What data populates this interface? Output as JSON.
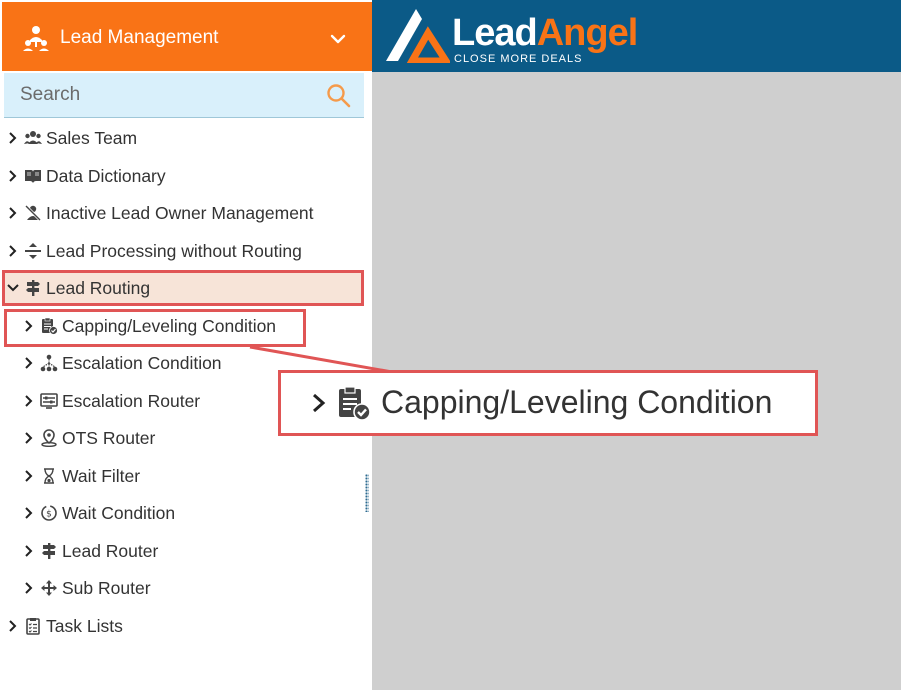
{
  "module_header": {
    "title": "Lead Management",
    "icon": "team-hierarchy-icon",
    "chevron": "chevron-down-icon",
    "bg_color": "#f97316"
  },
  "search": {
    "placeholder": "Search",
    "icon": "search-icon"
  },
  "brand": {
    "name_part1": "Lead",
    "name_part2": "Angel",
    "tagline": "CLOSE MORE DEALS",
    "bg_color": "#0b5a87",
    "accent_color": "#f97316"
  },
  "tree": {
    "items": [
      {
        "label": "Sales Team",
        "icon": "users-icon"
      },
      {
        "label": "Data Dictionary",
        "icon": "book-icon"
      },
      {
        "label": "Inactive Lead Owner Management",
        "icon": "user-slash-icon"
      },
      {
        "label": "Lead Processing without Routing",
        "icon": "split-arrows-icon"
      },
      {
        "label": "Lead Routing",
        "icon": "signpost-icon",
        "expanded": true,
        "highlighted": true
      },
      {
        "label": "Capping/Leveling Condition",
        "icon": "clipboard-check-icon",
        "highlighted": true
      },
      {
        "label": "Escalation Condition",
        "icon": "hierarchy-icon"
      },
      {
        "label": "Escalation Router",
        "icon": "sliders-icon"
      },
      {
        "label": "OTS Router",
        "icon": "map-pin-icon"
      },
      {
        "label": "Wait Filter",
        "icon": "hourglass-icon"
      },
      {
        "label": "Wait Condition",
        "icon": "clock-dollar-icon"
      },
      {
        "label": "Lead Router",
        "icon": "signpost-icon"
      },
      {
        "label": "Sub Router",
        "icon": "move-arrows-icon"
      },
      {
        "label": "Task Lists",
        "icon": "checklist-icon"
      }
    ]
  },
  "callout": {
    "label": "Capping/Leveling Condition",
    "icon": "clipboard-check-icon",
    "border_color": "#e05555"
  },
  "colors": {
    "highlight_bg": "#f7e4d8",
    "highlight_border": "#e05555",
    "search_bg": "#d9f0fb",
    "content_bg": "#cfcfcf"
  }
}
